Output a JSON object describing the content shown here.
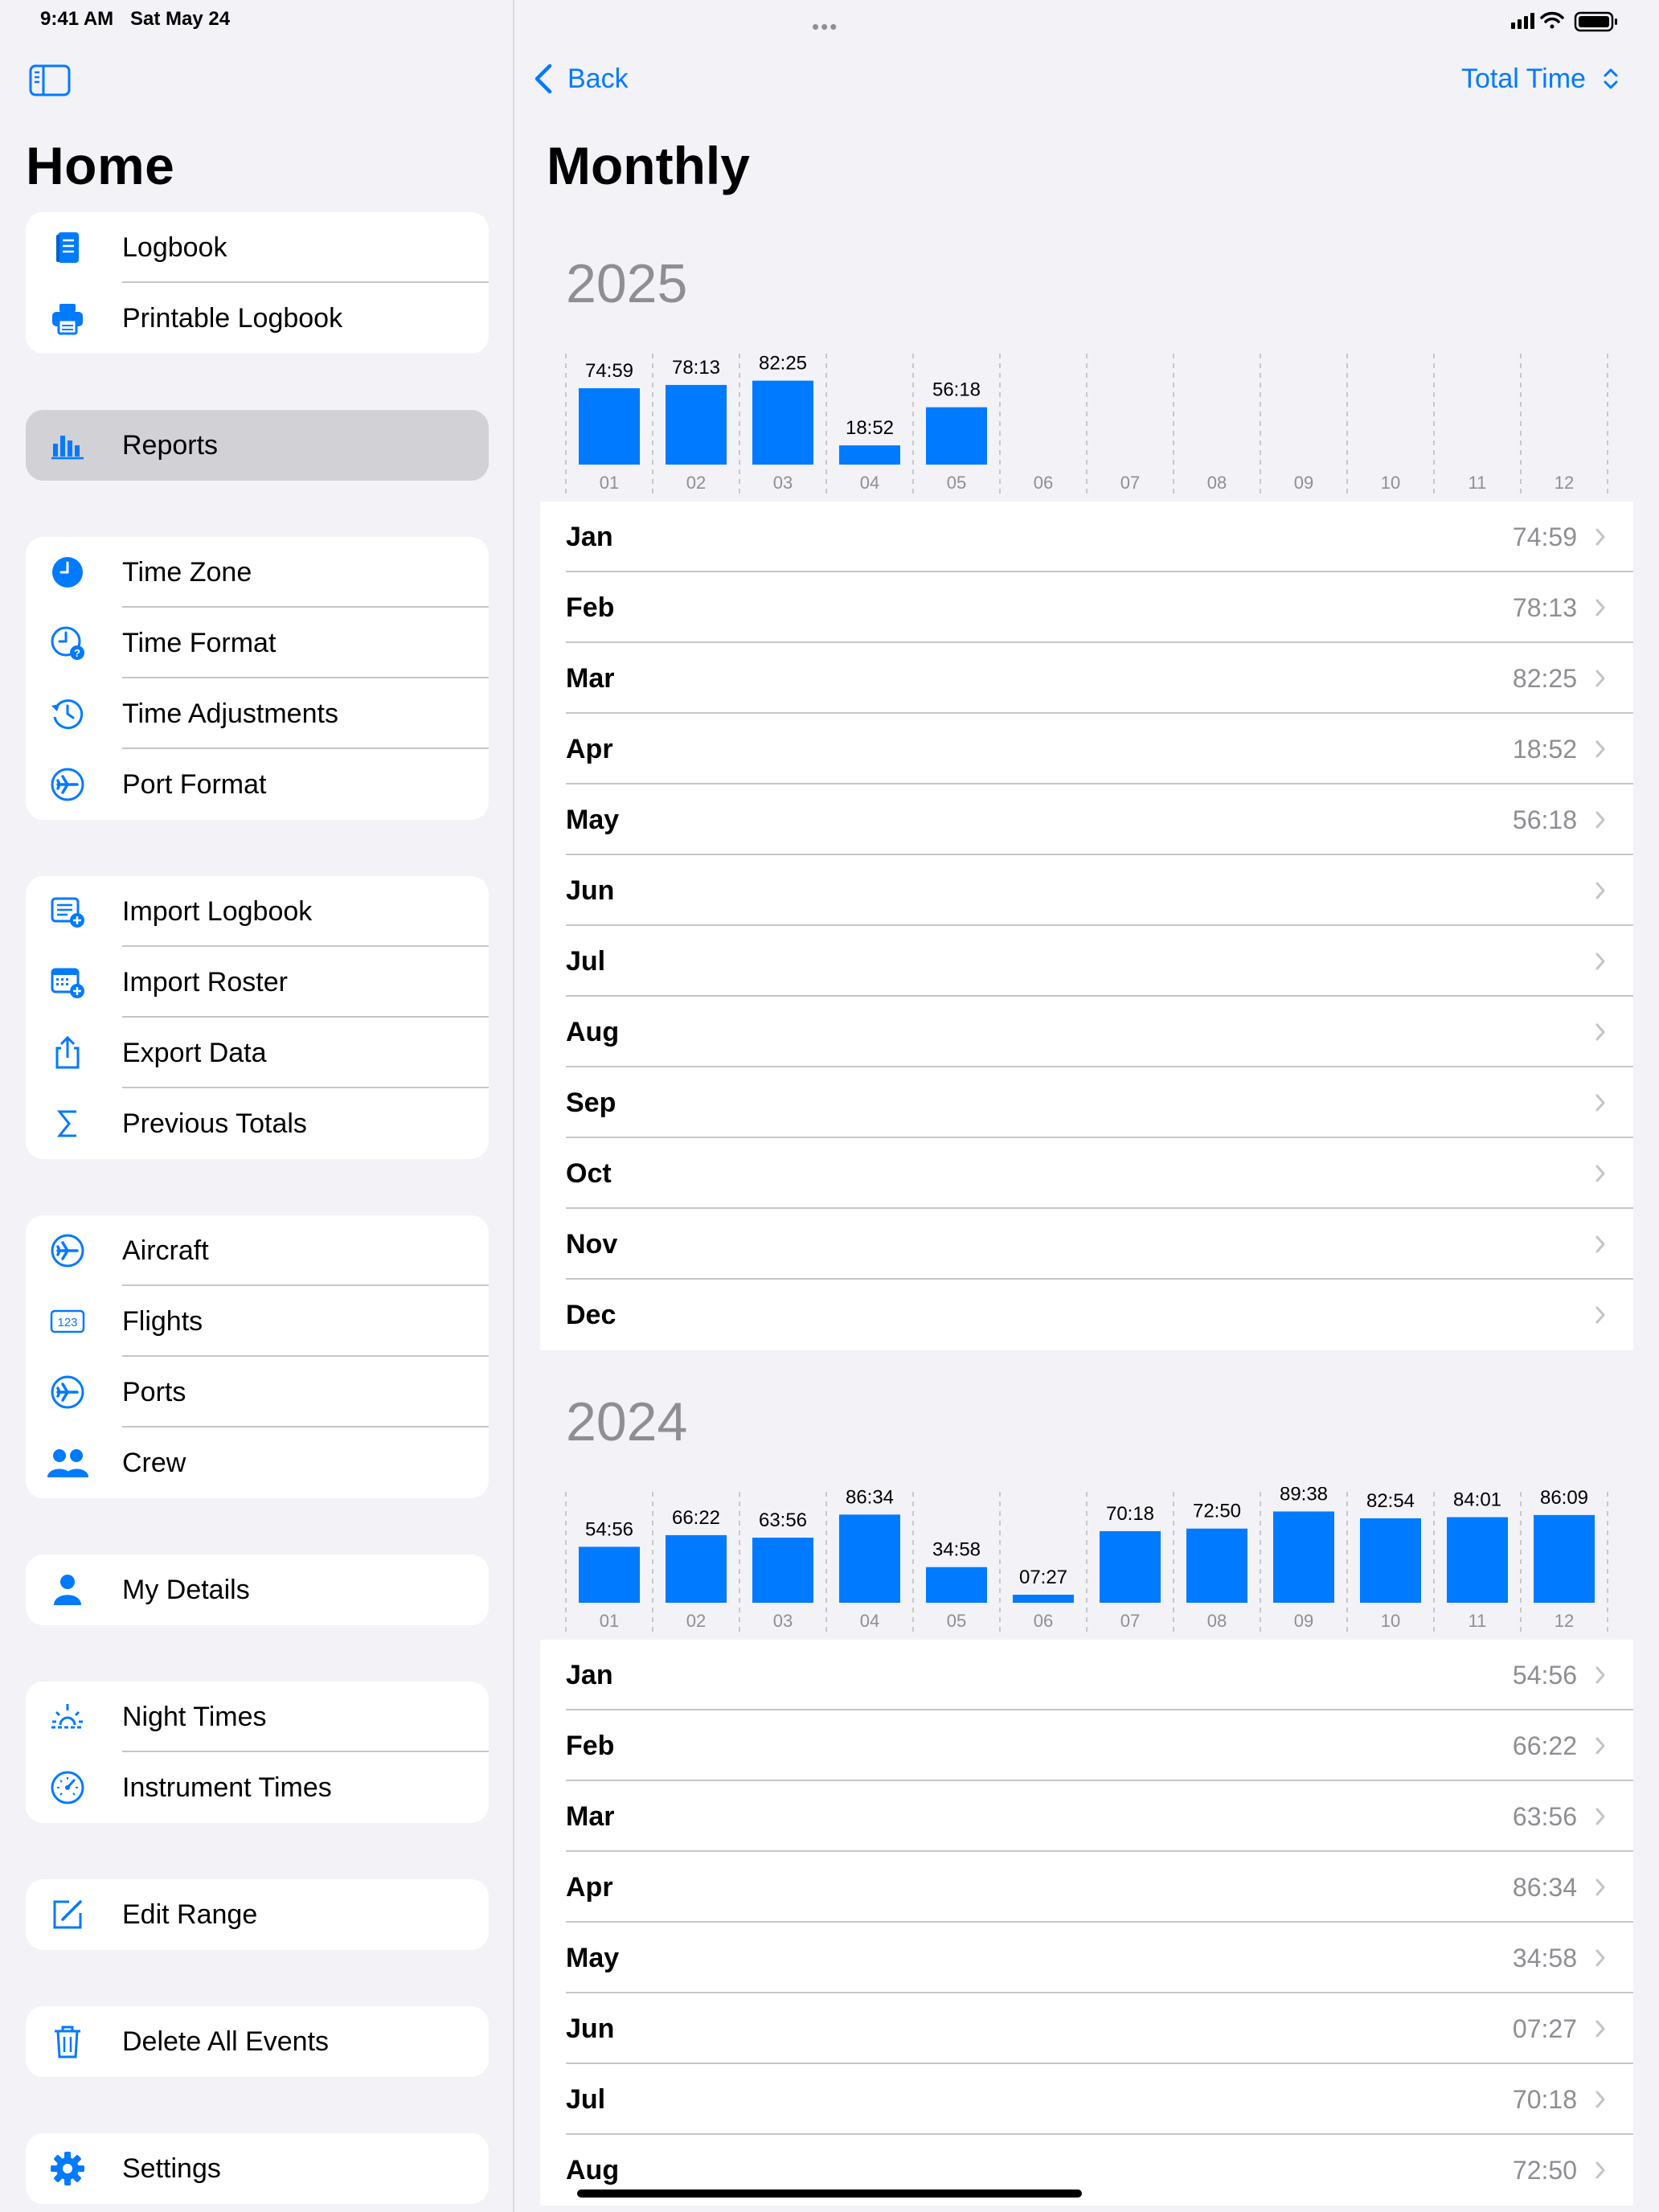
{
  "status": {
    "time": "9:41 AM",
    "date": "Sat May 24"
  },
  "sidebar": {
    "title": "Home",
    "groups": [
      {
        "items": [
          {
            "label": "Logbook",
            "icon": "logbook-icon"
          },
          {
            "label": "Printable Logbook",
            "icon": "printer-icon"
          }
        ]
      },
      {
        "items": [
          {
            "label": "Reports",
            "icon": "chart-bar-icon",
            "selected": true
          }
        ]
      },
      {
        "items": [
          {
            "label": "Time Zone",
            "icon": "clock-icon"
          },
          {
            "label": "Time Format",
            "icon": "clock-question-icon"
          },
          {
            "label": "Time Adjustments",
            "icon": "clock-rewind-icon"
          },
          {
            "label": "Port Format",
            "icon": "airplane-circle-icon"
          }
        ]
      },
      {
        "items": [
          {
            "label": "Import Logbook",
            "icon": "import-list-icon"
          },
          {
            "label": "Import Roster",
            "icon": "calendar-plus-icon"
          },
          {
            "label": "Export Data",
            "icon": "share-icon"
          },
          {
            "label": "Previous Totals",
            "icon": "sigma-icon"
          }
        ]
      },
      {
        "items": [
          {
            "label": "Aircraft",
            "icon": "airplane-circle-icon"
          },
          {
            "label": "Flights",
            "icon": "number-123-icon"
          },
          {
            "label": "Ports",
            "icon": "airplane-circle-icon"
          },
          {
            "label": "Crew",
            "icon": "people-icon"
          }
        ]
      },
      {
        "items": [
          {
            "label": "My Details",
            "icon": "person-icon"
          }
        ]
      },
      {
        "items": [
          {
            "label": "Night Times",
            "icon": "sunset-icon"
          },
          {
            "label": "Instrument Times",
            "icon": "gauge-icon"
          }
        ]
      },
      {
        "items": [
          {
            "label": "Edit Range",
            "icon": "edit-icon"
          }
        ]
      },
      {
        "items": [
          {
            "label": "Delete All Events",
            "icon": "trash-icon"
          }
        ]
      },
      {
        "items": [
          {
            "label": "Settings",
            "icon": "gear-icon"
          }
        ]
      }
    ]
  },
  "nav": {
    "back_label": "Back",
    "selector_label": "Total Time"
  },
  "main": {
    "title": "Monthly"
  },
  "colors": {
    "accent": "#007AFF",
    "secondary_text": "#8E8E93",
    "background": "#F2F2F7"
  },
  "years": [
    {
      "year": "2025",
      "rows": [
        {
          "month": "Jan",
          "value": "74:59"
        },
        {
          "month": "Feb",
          "value": "78:13"
        },
        {
          "month": "Mar",
          "value": "82:25"
        },
        {
          "month": "Apr",
          "value": "18:52"
        },
        {
          "month": "May",
          "value": "56:18"
        },
        {
          "month": "Jun",
          "value": ""
        },
        {
          "month": "Jul",
          "value": ""
        },
        {
          "month": "Aug",
          "value": ""
        },
        {
          "month": "Sep",
          "value": ""
        },
        {
          "month": "Oct",
          "value": ""
        },
        {
          "month": "Nov",
          "value": ""
        },
        {
          "month": "Dec",
          "value": ""
        }
      ]
    },
    {
      "year": "2024",
      "rows": [
        {
          "month": "Jan",
          "value": "54:56"
        },
        {
          "month": "Feb",
          "value": "66:22"
        },
        {
          "month": "Mar",
          "value": "63:56"
        },
        {
          "month": "Apr",
          "value": "86:34"
        },
        {
          "month": "May",
          "value": "34:58"
        },
        {
          "month": "Jun",
          "value": "07:27"
        },
        {
          "month": "Jul",
          "value": "70:18"
        },
        {
          "month": "Aug",
          "value": "72:50"
        }
      ]
    }
  ],
  "chart_data": [
    {
      "type": "bar",
      "title": "2025",
      "categories": [
        "01",
        "02",
        "03",
        "04",
        "05",
        "06",
        "07",
        "08",
        "09",
        "10",
        "11",
        "12"
      ],
      "values": [
        74.98,
        78.22,
        82.42,
        18.87,
        56.3,
        null,
        null,
        null,
        null,
        null,
        null,
        null
      ],
      "labels": [
        "74:59",
        "78:13",
        "82:25",
        "18:52",
        "56:18",
        "",
        "",
        "",
        "",
        "",
        "",
        ""
      ],
      "grid": true
    },
    {
      "type": "bar",
      "title": "2024",
      "categories": [
        "01",
        "02",
        "03",
        "04",
        "05",
        "06",
        "07",
        "08",
        "09",
        "10",
        "11",
        "12"
      ],
      "values": [
        54.93,
        66.37,
        63.93,
        86.57,
        34.97,
        7.45,
        70.3,
        72.83,
        89.63,
        82.9,
        84.02,
        86.15
      ],
      "labels": [
        "54:56",
        "66:22",
        "63:56",
        "86:34",
        "34:58",
        "07:27",
        "70:18",
        "72:50",
        "89:38",
        "82:54",
        "84:01",
        "86:09"
      ],
      "grid": true
    }
  ]
}
